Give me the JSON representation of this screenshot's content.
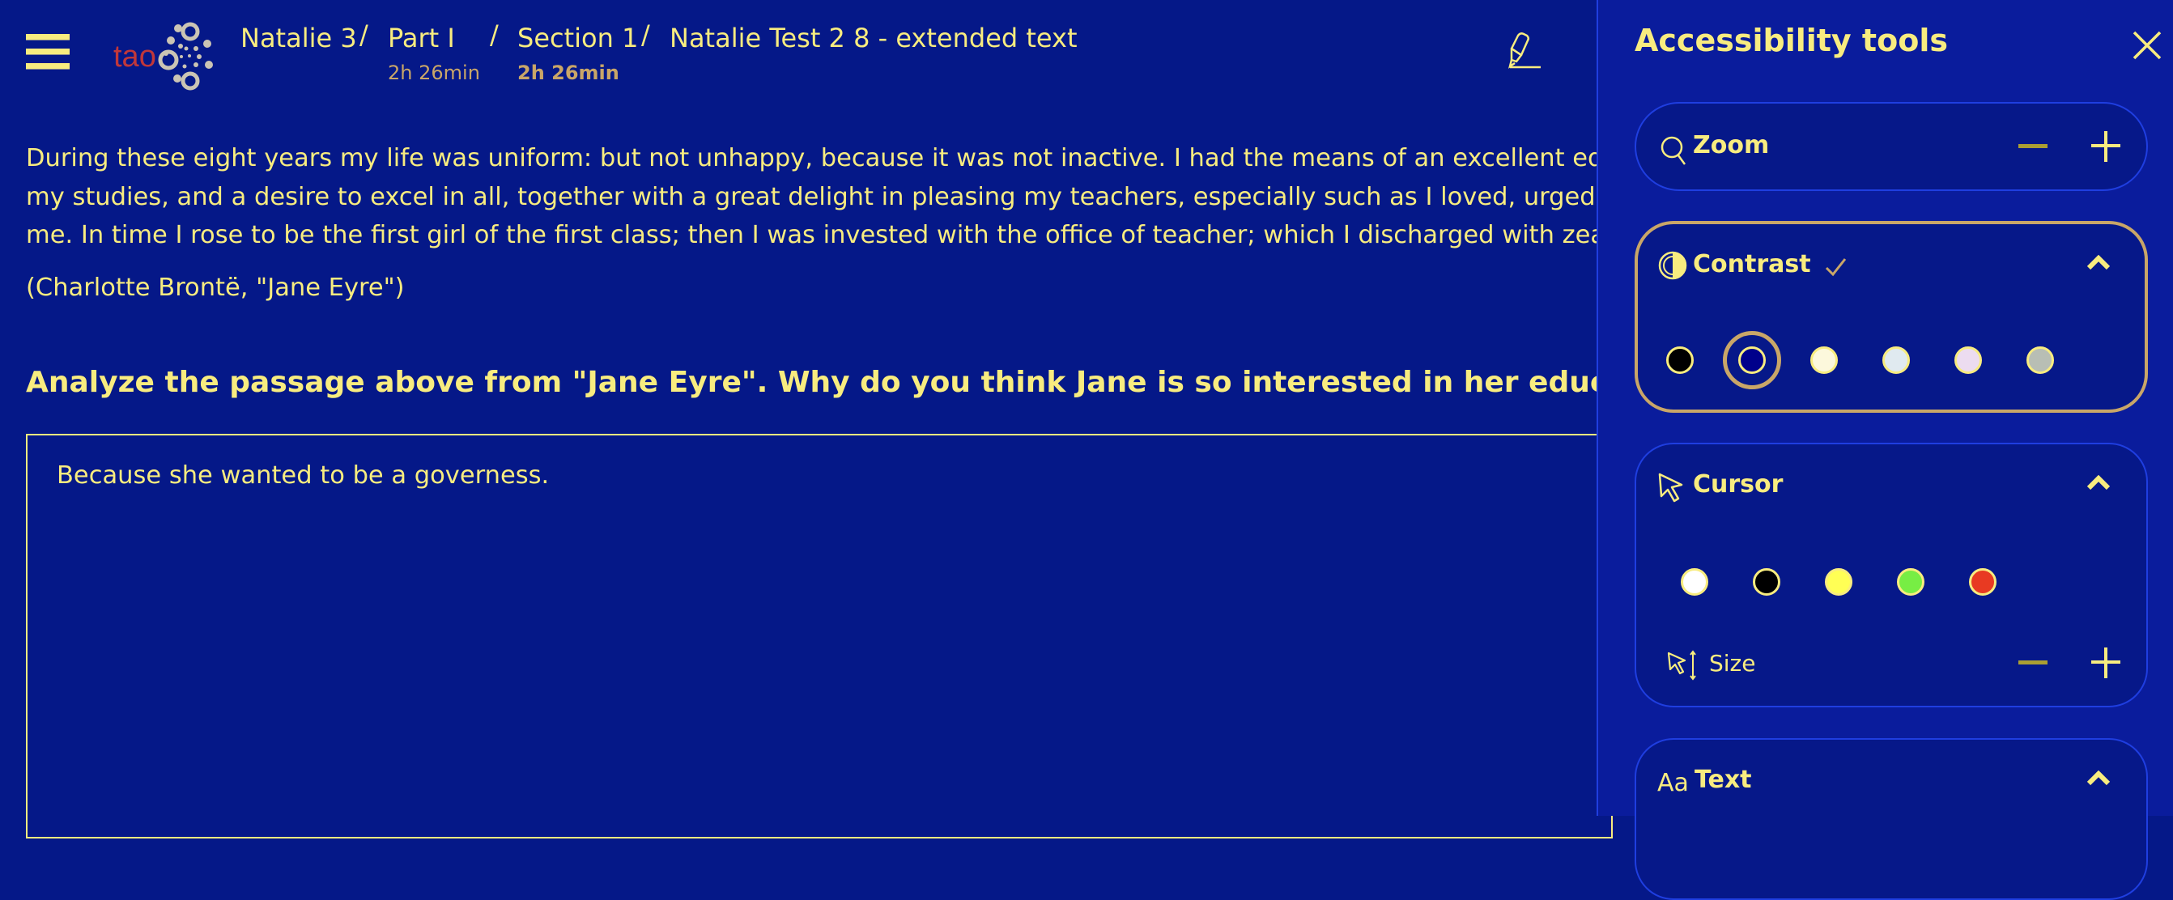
{
  "header": {
    "menu_icon": "hamburger-menu-icon",
    "logo_text": "tao",
    "breadcrumb": [
      {
        "label": "Natalie 3",
        "timer": ""
      },
      {
        "label": "Part I",
        "timer": "2h 26min"
      },
      {
        "label": "Section 1",
        "timer": "2h 26min"
      },
      {
        "label": "Natalie Test 2 8 - extended text",
        "timer": ""
      }
    ],
    "separator": "/",
    "highlighter_icon": "highlighter-pen-icon"
  },
  "content": {
    "passage_lines": [
      "During these eight years my life was uniform: but not unhappy, because it was not inactive. I had the means of an excellent education placed within my reach; a fondness for some of",
      "my studies, and a desire to excel in all, together with a great delight in pleasing my teachers, especially such as I loved, urged me on: I availed myself fully of the advantages offered",
      "me. In time I rose to be the first girl of the first class; then I was invested with the office of teacher; which I discharged with zeal for two years: but at the end of that time I altered."
    ],
    "citation": "(Charlotte Brontë, \"Jane Eyre\")",
    "question": "Analyze the passage above from \"Jane Eyre\". Why do you think Jane is so interested in her education?",
    "answer": "Because she wanted to be a governess."
  },
  "panel": {
    "title": "Accessibility tools",
    "close_icon": "close-icon",
    "zoom": {
      "label": "Zoom",
      "minus": "−",
      "plus": "+"
    },
    "contrast": {
      "label": "Contrast",
      "enabled": true,
      "expanded": true,
      "selected_index": 1,
      "swatches": [
        "#000000",
        "#00008b",
        "#fcf8dc",
        "#e0eaf0",
        "#ecdcf0",
        "#b8beb4"
      ]
    },
    "cursor": {
      "label": "Cursor",
      "expanded": true,
      "colors": [
        "#ffffff",
        "#000000",
        "#ffff55",
        "#77ee44",
        "#e83a22"
      ],
      "size_label": "Size",
      "minus": "−",
      "plus": "+"
    },
    "text": {
      "label": "Text",
      "icon_text": "Aa",
      "expanded": true
    }
  },
  "colors": {
    "background": "#051888",
    "panel_background": "#0a1c9c",
    "foreground": "#f8ec7f",
    "accent_tan": "#c9a668",
    "card_border": "#1f3ee0",
    "logo_red": "#c0373a",
    "logo_gray": "#cbc4b4"
  }
}
